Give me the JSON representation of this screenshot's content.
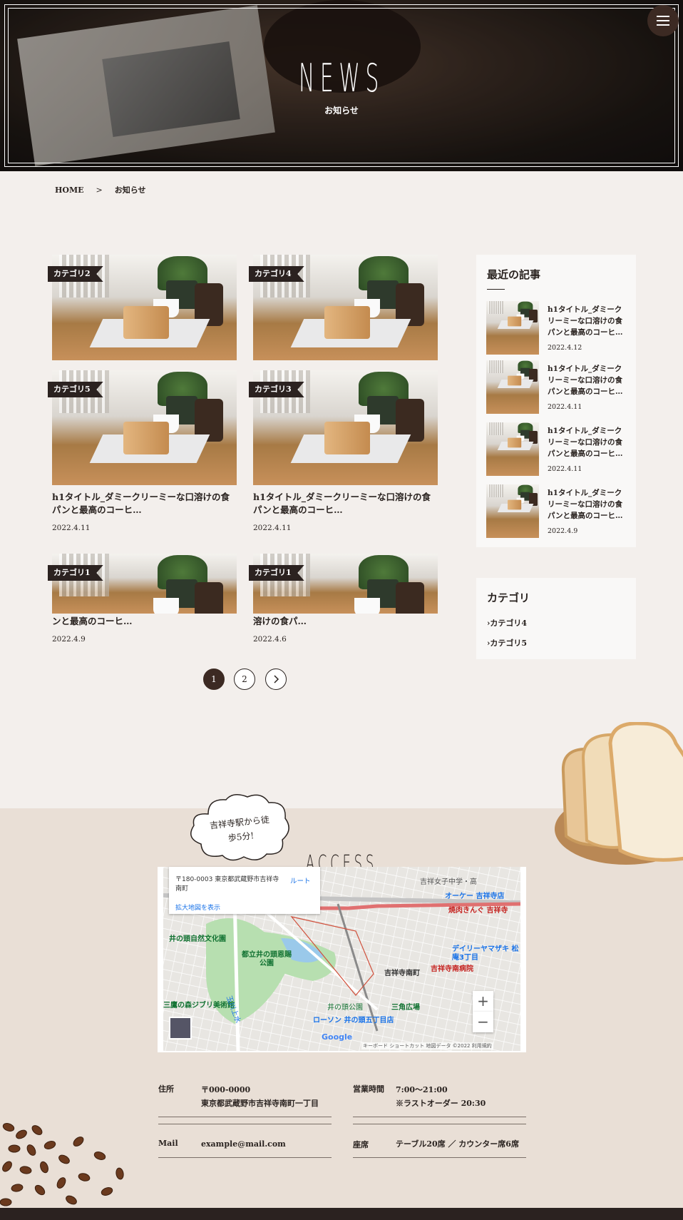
{
  "header": {
    "title": "NEWS",
    "subtitle": "お知らせ",
    "menu_icon": "hamburger-icon"
  },
  "breadcrumb": {
    "home": "HOME",
    "separator": ">",
    "current": "お知らせ"
  },
  "posts": [
    {
      "category": "カテゴリ2",
      "title": "",
      "date": ""
    },
    {
      "category": "カテゴリ4",
      "title": "",
      "date": ""
    },
    {
      "category": "カテゴリ5",
      "title": "h1タイトル_ダミークリーミーな口溶けの食パンと最高のコーヒ…",
      "date": "2022.4.11"
    },
    {
      "category": "カテゴリ3",
      "title": "h1タイトル_ダミークリーミーな口溶けの食パンと最高のコーヒ…",
      "date": "2022.4.11"
    },
    {
      "category": "カテゴリ1",
      "title": "ンと最高のコーヒ…",
      "date": "2022.4.9"
    },
    {
      "category": "カテゴリ1",
      "title": "溶けの食パ…",
      "date": "2022.4.6"
    }
  ],
  "pagination": {
    "pages": [
      "1",
      "2"
    ],
    "current": "1",
    "next_icon": "chevron-right-icon"
  },
  "sidebar": {
    "recent_heading": "最近の記事",
    "recent": [
      {
        "title": "h1タイトル_ダミークリーミーな口溶けの食パンと最高のコーヒ…",
        "date": "2022.4.12"
      },
      {
        "title": "h1タイトル_ダミークリーミーな口溶けの食パンと最高のコーヒ…",
        "date": "2022.4.11"
      },
      {
        "title": "h1タイトル_ダミークリーミーな口溶けの食パンと最高のコーヒ…",
        "date": "2022.4.11"
      },
      {
        "title": "h1タイトル_ダミークリーミーな口溶けの食パンと最高のコーヒ…",
        "date": "2022.4.9"
      }
    ],
    "category_heading": "カテゴリ",
    "categories": [
      "カテゴリ4",
      "カテゴリ5"
    ]
  },
  "access": {
    "callout": "吉祥寺駅から徒歩5分!",
    "title": "ACCESS",
    "map": {
      "address": "〒180-0003 東京都武蔵野市吉祥寺南町",
      "route_label": "ルート",
      "larger_map": "拡大地図を表示",
      "labels": [
        "吉祥女子中学・高",
        "オーケー 吉祥寺店",
        "焼肉きんぐ 吉祥寺",
        "井の頭自然文化園",
        "都立井の頭恩賜公園",
        "吉祥寺南町",
        "吉祥寺南病院",
        "デイリーヤマザキ 松庵3丁目",
        "三角広場",
        "ローソン 井の頭五丁目店",
        "三鷹の森ジブリ美術館",
        "井の頭公園",
        "玉川上水"
      ],
      "zoom_in": "+",
      "zoom_out": "−",
      "attribution": "キーボード ショートカット  地図データ ©2022  利用規約",
      "google": "Google"
    },
    "info": {
      "address_label": "住所",
      "postal": "〒000-0000",
      "address": "東京都武蔵野市吉祥寺南町一丁目",
      "hours_label": "営業時間",
      "hours": "7:00〜21:00",
      "last_order": "※ラストオーダー 20:30",
      "mail_label": "Mail",
      "mail": "example@mail.com",
      "seats_label": "座席",
      "seats": "テーブル20席 ／ カウンター席6席"
    }
  },
  "colors": {
    "brand_dark": "#3c2a23",
    "page_bg": "#f3efec",
    "access_bg": "#e9dfd6"
  }
}
